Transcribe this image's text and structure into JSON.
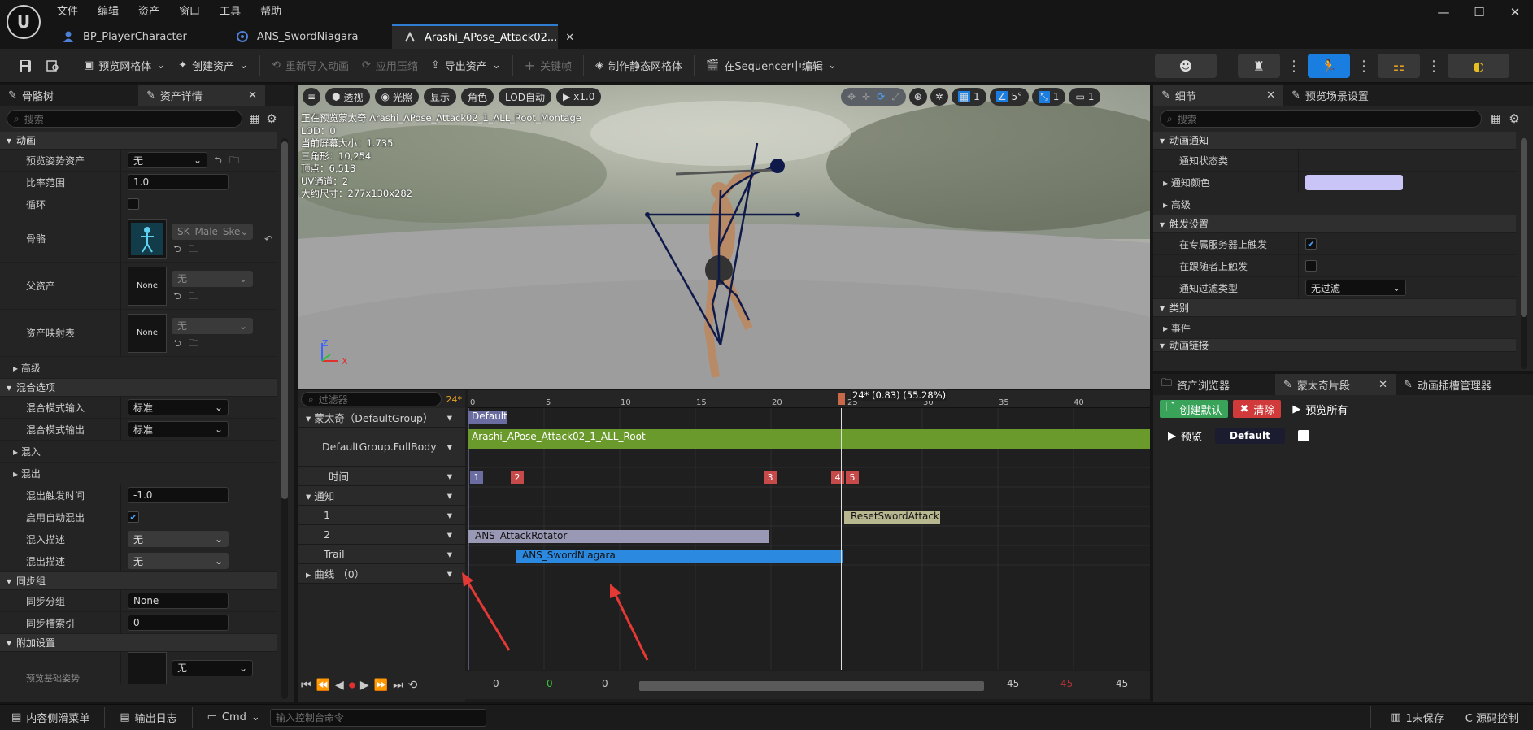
{
  "app": {
    "menu": [
      "文件",
      "编辑",
      "资产",
      "窗口",
      "工具",
      "帮助"
    ]
  },
  "tabs": [
    {
      "label": "BP_PlayerCharacter"
    },
    {
      "label": "ANS_SwordNiagara"
    },
    {
      "label": "Arashi_APose_Attack02..."
    }
  ],
  "toolbar": {
    "preview_mesh": "预览网格体",
    "create_asset": "创建资产",
    "reimport": "重新导入动画",
    "apply_compression": "应用压缩",
    "export_asset": "导出资产",
    "keyframe": "关键帧",
    "make_static_mesh": "制作静态网格体",
    "edit_in_sequencer": "在Sequencer中编辑"
  },
  "left_panel": {
    "tab_skeleton": "骨骼树",
    "tab_asset_details": "资产详情",
    "search_placeholder": "搜索",
    "cat_animation": "动画",
    "preview_pose_asset": "预览姿势资产",
    "preview_pose_value": "无",
    "rate_scale": "比率范围",
    "rate_scale_value": "1.0",
    "loop": "循环",
    "skeleton": "骨骼",
    "skeleton_value": "SK_Male_Ske",
    "parent_asset": "父资产",
    "parent_asset_value": "无",
    "asset_mapping": "资产映射表",
    "asset_mapping_value": "无",
    "none_thumb": "None",
    "cat_advanced": "高级",
    "cat_blend_options": "混合选项",
    "blend_mode_in": "混合模式输入",
    "blend_mode_in_value": "标准",
    "blend_mode_out": "混合模式输出",
    "blend_mode_out_value": "标准",
    "blend_in": "混入",
    "blend_out": "混出",
    "blend_out_trigger": "混出触发时间",
    "blend_out_trigger_value": "-1.0",
    "enable_auto_blend_out": "启用自动混出",
    "blend_in_profile": "混入描述",
    "blend_in_profile_value": "无",
    "blend_out_profile": "混出描述",
    "blend_out_profile_value": "无",
    "cat_sync_group": "同步组",
    "sync_group": "同步分组",
    "sync_group_value": "None",
    "sync_slot_index": "同步槽索引",
    "sync_slot_index_value": "0",
    "cat_additional": "附加设置",
    "additional_partial": "预览基础姿势",
    "additional_value": "无"
  },
  "viewport": {
    "menu_btn": "≡",
    "perspective": "透视",
    "lit": "光照",
    "show": "显示",
    "character": "角色",
    "lod": "LOD自动",
    "play_rate": "x1.0",
    "grid_value": "1",
    "angle_value": "5°",
    "scale_value": "1",
    "camera_value": "1",
    "info": [
      "正在预览蒙太奇 Arashi_APose_Attack02_1_ALL_Root_Montage",
      "LOD：0",
      "当前屏幕大小：1.735",
      "三角形：10,254",
      "顶点：6,513",
      "UV通道：2",
      "大约尺寸：277x130x282"
    ],
    "axis_z": "Z",
    "axis_x": "X"
  },
  "timeline": {
    "filter_placeholder": "过滤器",
    "fps": "24*",
    "playhead_label": "24* (0.83) (55.28%)",
    "ruler_ticks": [
      "0",
      "5",
      "10",
      "15",
      "20",
      "25",
      "30",
      "35",
      "40"
    ],
    "tracks": {
      "montage": "蒙太奇（DefaultGroup）",
      "slot": "DefaultGroup.FullBody",
      "timing": "时间",
      "notifies": "通知",
      "track1": "1",
      "track2": "2",
      "trail": "Trail",
      "curves": "曲线 （0）"
    },
    "section_default": "Default",
    "segment_name": "Arashi_APose_Attack02_1_ALL_Root",
    "timing_markers": [
      "1",
      "2",
      "3",
      "4",
      "5"
    ],
    "notify_reset": "ResetSwordAttack",
    "notify_rotator": "ANS_AttackRotator",
    "notify_niagara": "ANS_SwordNiagara",
    "transport_values": [
      "0",
      "0",
      "0",
      "45",
      "45",
      "45"
    ]
  },
  "right_panel": {
    "tab_details": "细节",
    "tab_preview_scene": "预览场景设置",
    "search_placeholder": "搜索",
    "cat_anim_notify": "动画通知",
    "notify_state_class": "通知状态类",
    "notify_color": "通知颜色",
    "notify_color_value": "#c9c6f7",
    "cat_advanced": "高级",
    "cat_trigger_settings": "触发设置",
    "trigger_on_dedicated_server": "在专属服务器上触发",
    "trigger_on_follower": "在跟随者上触发",
    "notify_filter_type": "通知过滤类型",
    "notify_filter_value": "无过滤",
    "cat_category": "类别",
    "cat_events": "事件",
    "cat_anim_link": "动画链接"
  },
  "bottom_right": {
    "tab_content_browser": "资产浏览器",
    "tab_montage_sections": "蒙太奇片段",
    "tab_slot_manager": "动画插槽管理器",
    "create_default": "创建默认",
    "clear": "清除",
    "preview_all": "预览所有",
    "preview": "预览",
    "default_section": "Default"
  },
  "statusbar": {
    "content_drawer": "内容侧滑菜单",
    "output_log": "输出日志",
    "cmd": "Cmd",
    "console_placeholder": "输入控制台命令",
    "unsaved": "1未保存",
    "source_control": "C 源码控制"
  }
}
